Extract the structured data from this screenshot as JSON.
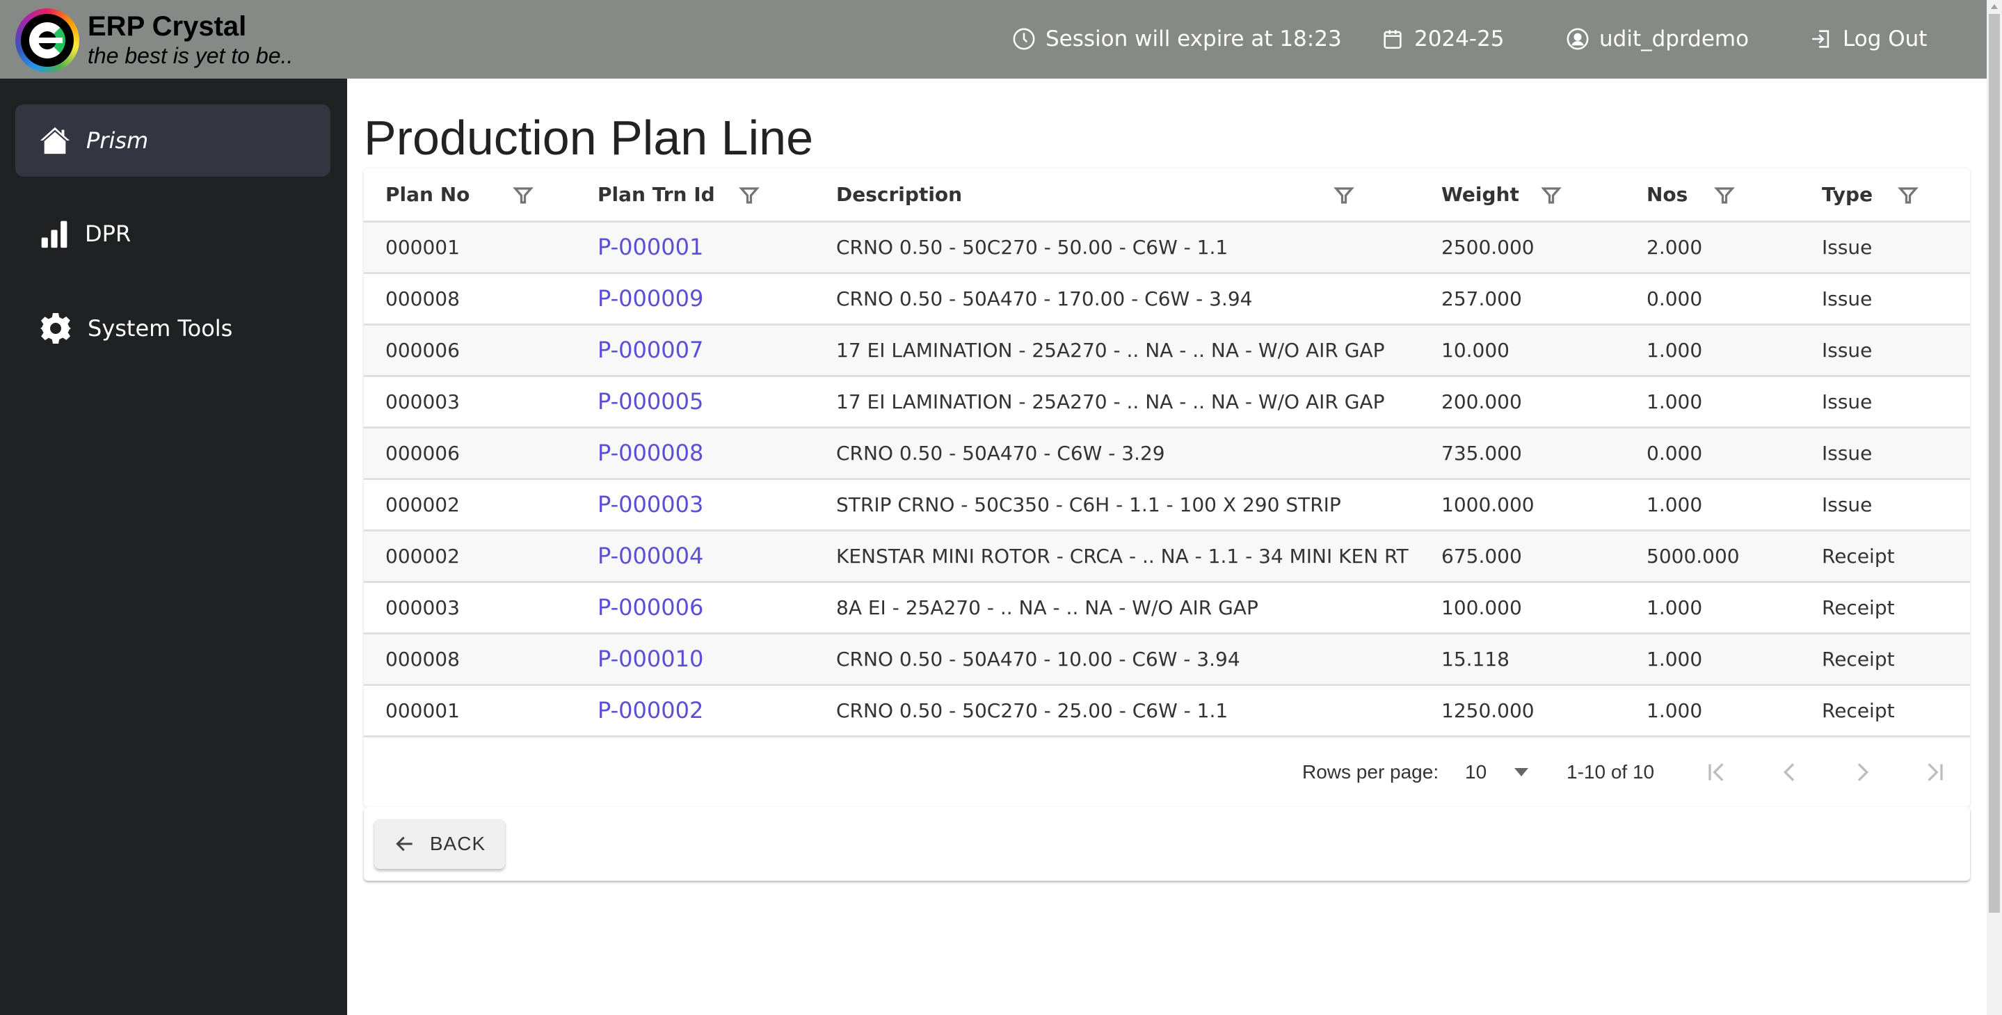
{
  "app": {
    "title": "ERP Crystal",
    "tagline": "the best is yet to be.."
  },
  "header": {
    "session": "Session will expire at 18:23",
    "year": "2024-25",
    "user": "udit_dprdemo",
    "logout": "Log Out"
  },
  "sidebar": {
    "items": [
      {
        "label": "Prism",
        "icon": "home-icon",
        "active": true
      },
      {
        "label": "DPR",
        "icon": "bar-chart-icon",
        "active": false
      },
      {
        "label": "System Tools",
        "icon": "gear-icon",
        "active": false
      }
    ]
  },
  "page": {
    "title": "Production Plan Line"
  },
  "table": {
    "columns": [
      "Plan No",
      "Plan Trn Id",
      "Description",
      "Weight",
      "Nos",
      "Type"
    ],
    "rows": [
      [
        "000001",
        "P-000001",
        "CRNO 0.50 - 50C270 - 50.00 - C6W - 1.1",
        "2500.000",
        "2.000",
        "Issue"
      ],
      [
        "000008",
        "P-000009",
        "CRNO 0.50 - 50A470 - 170.00 - C6W - 3.94",
        "257.000",
        "0.000",
        "Issue"
      ],
      [
        "000006",
        "P-000007",
        "17 EI LAMINATION - 25A270 - .. NA - .. NA - W/O AIR GAP",
        "10.000",
        "1.000",
        "Issue"
      ],
      [
        "000003",
        "P-000005",
        "17 EI LAMINATION - 25A270 - .. NA - .. NA - W/O AIR GAP",
        "200.000",
        "1.000",
        "Issue"
      ],
      [
        "000006",
        "P-000008",
        "CRNO 0.50 - 50A470 - C6W - 3.29",
        "735.000",
        "0.000",
        "Issue"
      ],
      [
        "000002",
        "P-000003",
        "STRIP CRNO - 50C350 - C6H - 1.1 - 100 X 290 STRIP",
        "1000.000",
        "1.000",
        "Issue"
      ],
      [
        "000002",
        "P-000004",
        "KENSTAR MINI ROTOR - CRCA - .. NA - 1.1 - 34 MINI KEN RT",
        "675.000",
        "5000.000",
        "Receipt"
      ],
      [
        "000003",
        "P-000006",
        "8A EI - 25A270 - .. NA - .. NA - W/O AIR GAP",
        "100.000",
        "1.000",
        "Receipt"
      ],
      [
        "000008",
        "P-000010",
        "CRNO 0.50 - 50A470 - 10.00 - C6W - 3.94",
        "15.118",
        "1.000",
        "Receipt"
      ],
      [
        "000001",
        "P-000002",
        "CRNO 0.50 - 50C270 - 25.00 - C6W - 1.1",
        "1250.000",
        "1.000",
        "Receipt"
      ]
    ]
  },
  "pagination": {
    "rows_per_page_label": "Rows per page:",
    "rows_per_page": "10",
    "range": "1-10 of 10"
  },
  "actions": {
    "back_label": "BACK"
  },
  "colors": {
    "header_bg": "#868a86",
    "sidebar_bg": "#202123",
    "sidebar_active": "#353541",
    "link": "#5b4fd6"
  }
}
